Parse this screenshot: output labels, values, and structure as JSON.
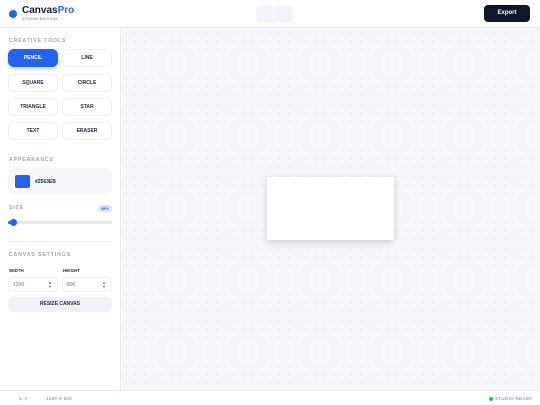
{
  "app": {
    "name": "Canvas",
    "name_accent": "Pro",
    "edition": "STUDIO EDITION",
    "export_label": "Export",
    "accent_color": "#2563EB"
  },
  "sidebar": {
    "tools_title": "CREATIVE TOOLS",
    "tools": [
      {
        "label": "PENCIL",
        "active": true
      },
      {
        "label": "LINE",
        "active": false
      },
      {
        "label": "SQUARE",
        "active": false
      },
      {
        "label": "CIRCLE",
        "active": false
      },
      {
        "label": "TRIANGLE",
        "active": false
      },
      {
        "label": "STAR",
        "active": false
      },
      {
        "label": "TEXT",
        "active": false
      },
      {
        "label": "ERASER",
        "active": false
      }
    ],
    "appearance_title": "APPEARANCE",
    "color_hex": "#2563EB",
    "size_label": "SIZE",
    "size_value": "5PX",
    "size_fraction": 0.05,
    "canvas_settings_title": "CANVAS SETTINGS",
    "width_label": "WIDTH",
    "width_value": "1200",
    "height_label": "HEIGHT",
    "height_value": "800",
    "resize_label": "RESIZE CANVAS"
  },
  "status": {
    "coords": "0, 0",
    "dimensions": "1200 X 800",
    "ready": "STUDIO READY",
    "ready_color": "#22C55E"
  }
}
